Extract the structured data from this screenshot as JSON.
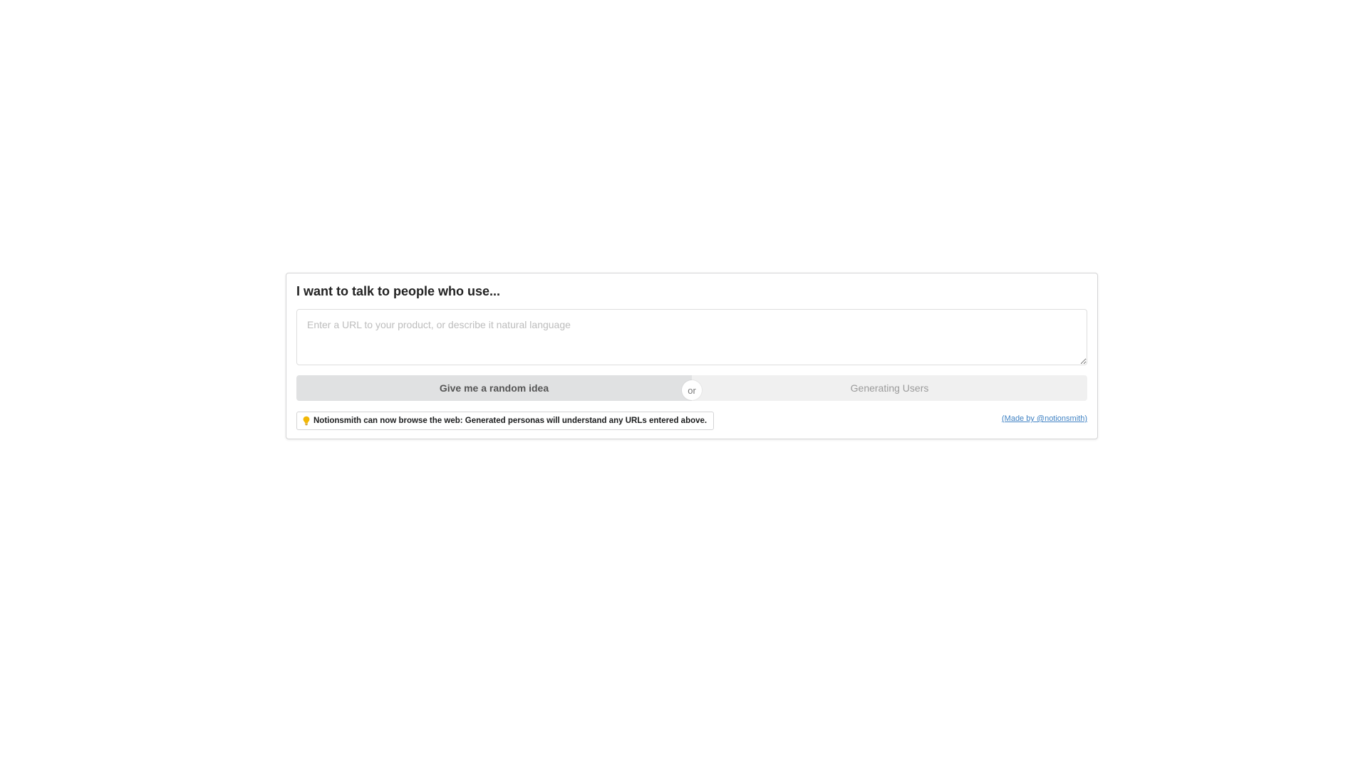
{
  "form": {
    "heading": "I want to talk to people who use...",
    "input": {
      "value": "",
      "placeholder": "Enter a URL to your product, or describe it natural language"
    },
    "random_button_label": "Give me a random idea",
    "divider_label": "or",
    "generate_button_label": "Generating Users",
    "generate_button_state": "disabled"
  },
  "notice": {
    "icon": "lightbulb-icon",
    "text": "Notionsmith can now browse the web: Generated personas will understand any URLs entered above."
  },
  "credit": {
    "text": "(Made by @notionsmith)"
  },
  "colors": {
    "accent_link": "#4183c4",
    "bulb": "#f2b705",
    "button_primary_bg": "#e0e1e2",
    "button_disabled_bg": "#f0f0f0"
  }
}
